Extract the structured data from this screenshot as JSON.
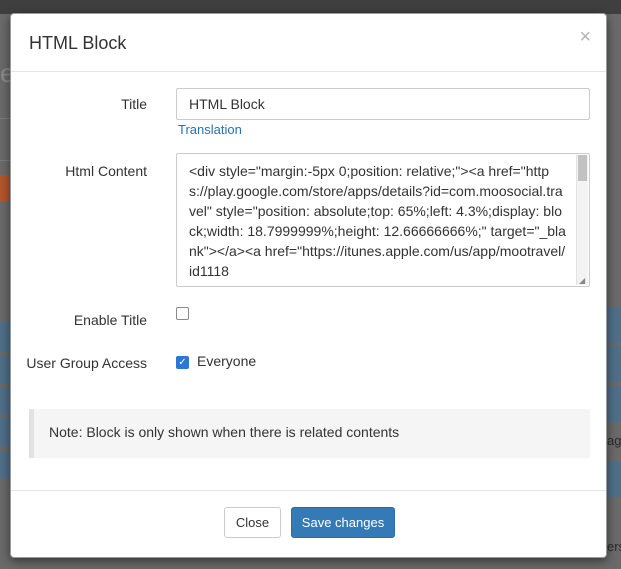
{
  "dialog": {
    "title": "HTML Block",
    "close_glyph": "×"
  },
  "form": {
    "title_label": "Title",
    "title_value": "HTML Block",
    "translation_link": "Translation",
    "html_content_label": "Html Content",
    "html_content_value": "<div style=\"margin:-5px 0;position: relative;\"><a href=\"https://play.google.com/store/apps/details?id=com.moosocial.travel\" style=\"position: absolute;top: 65%;left: 4.3%;display: block;width: 18.7999999%;height: 12.66666666%;\" target=\"_blank\"></a><a href=\"https://itunes.apple.com/us/app/mootravel/id1118",
    "enable_title_label": "Enable Title",
    "enable_title_checked": false,
    "user_group_label": "User Group Access",
    "everyone_label": "Everyone",
    "everyone_checked": true
  },
  "note": "Note: Block is only shown when there is related contents",
  "footer": {
    "close_label": "Close",
    "save_label": "Save changes"
  },
  "background": {
    "letter": "e",
    "right_text_1": "ag",
    "right_text_2": "ers"
  },
  "colors": {
    "primary": "#337ab7",
    "link": "#2a6fb0",
    "checkbox_checked": "#2b78d4"
  }
}
